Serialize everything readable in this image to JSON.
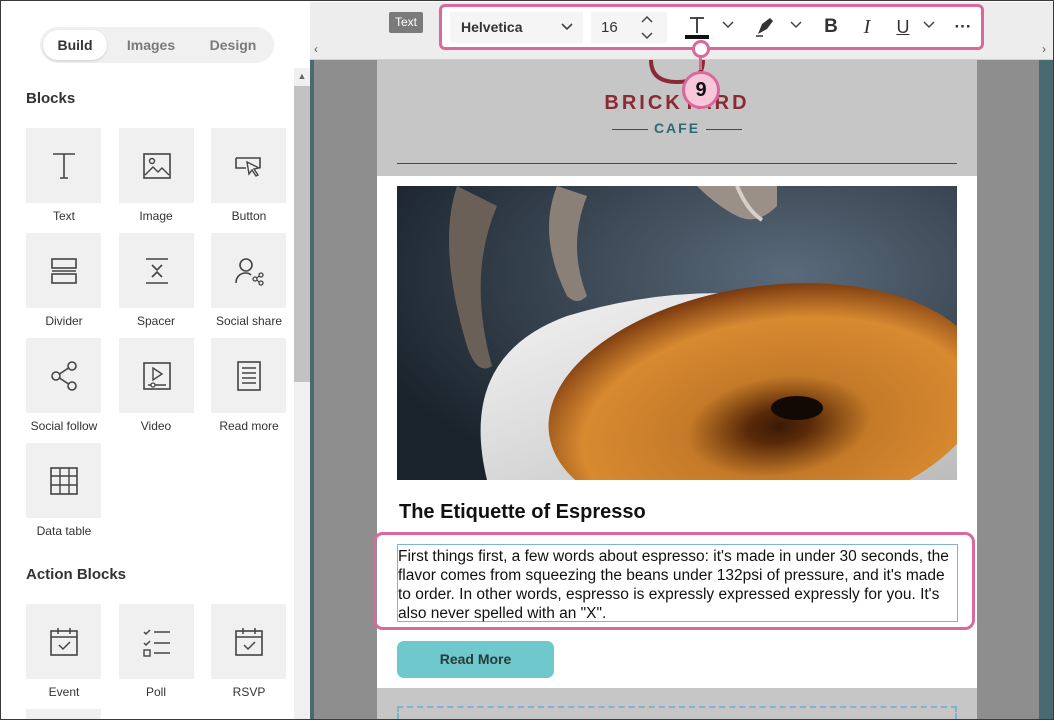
{
  "sidebar": {
    "tabs": [
      {
        "label": "Build",
        "active": true
      },
      {
        "label": "Images",
        "active": false
      },
      {
        "label": "Design",
        "active": false
      }
    ],
    "blocks_title": "Blocks",
    "blocks": [
      {
        "label": "Text",
        "icon": "text-icon"
      },
      {
        "label": "Image",
        "icon": "image-icon"
      },
      {
        "label": "Button",
        "icon": "button-icon"
      },
      {
        "label": "Divider",
        "icon": "divider-icon"
      },
      {
        "label": "Spacer",
        "icon": "spacer-icon"
      },
      {
        "label": "Social share",
        "icon": "social-share-icon"
      },
      {
        "label": "Social follow",
        "icon": "social-follow-icon"
      },
      {
        "label": "Video",
        "icon": "video-icon"
      },
      {
        "label": "Read more",
        "icon": "read-more-icon"
      },
      {
        "label": "Data table",
        "icon": "data-table-icon"
      }
    ],
    "action_blocks_title": "Action Blocks",
    "action_blocks": [
      {
        "label": "Event",
        "icon": "event-calendar-icon"
      },
      {
        "label": "Poll",
        "icon": "poll-icon"
      },
      {
        "label": "RSVP",
        "icon": "rsvp-calendar-icon"
      }
    ]
  },
  "toolbar": {
    "element_badge": "Text",
    "font_family": "Helvetica",
    "font_size": "16",
    "buttons": [
      "text-color-icon",
      "highlight-icon",
      "bold-icon",
      "italic-icon",
      "underline-icon",
      "more-icon"
    ]
  },
  "callout": {
    "number": "9"
  },
  "email": {
    "logo_main": "BRICKYARD",
    "logo_sub": "CAFE",
    "headline": "The Etiquette of Espresso",
    "body": "First things first, a few words about espresso: it's made in under 30 seconds, the flavor comes from squeezing the beans under 132psi of pressure, and it's made to order. In other words, espresso is expressly expressed expressly for you. It's also never spelled with an \"X\".",
    "button_label": "Read More"
  },
  "colors": {
    "accent_pink": "#d8699a",
    "teal_button": "#6ec8cc",
    "brand_red": "#8a2a35",
    "brand_teal": "#2c6c70"
  }
}
